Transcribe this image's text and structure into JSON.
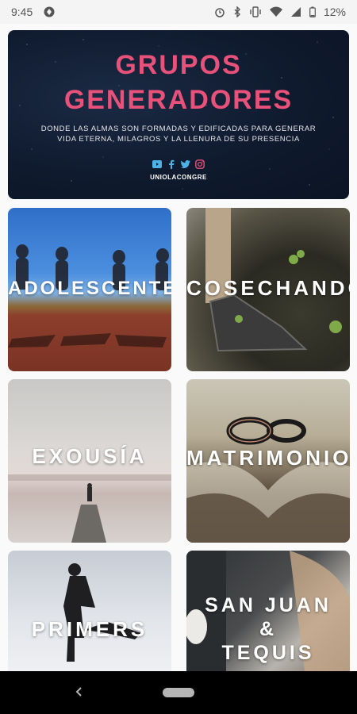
{
  "status_bar": {
    "time": "9:45",
    "battery": "12%",
    "icons": [
      "app-notification-icon",
      "alarm-icon",
      "bluetooth-icon",
      "vibrate-icon",
      "wifi-icon",
      "signal-icon",
      "battery-icon"
    ]
  },
  "hero": {
    "title_line1": "GRUPOS",
    "title_line2": "GENERADORES",
    "subtitle_line1": "DONDE LAS ALMAS SON FORMADAS Y EDIFICADAS PARA GENERAR",
    "subtitle_line2": "VIDA ETERNA, MILAGROS Y LA LLENURA DE SU PRESENCIA",
    "handle": "UNIOLACONGRE",
    "social_icons": [
      "youtube-icon",
      "facebook-icon",
      "twitter-icon",
      "instagram-icon"
    ],
    "accent_color": "#e8517a",
    "background_color": "#0f1a2e"
  },
  "groups": [
    {
      "label": "ADOLESCENTES"
    },
    {
      "label": "COSECHANDO"
    },
    {
      "label": "EXOUSÍA"
    },
    {
      "label": "MATRIMONIOS"
    },
    {
      "label": "PRIMERS"
    },
    {
      "label_line1": "SAN JUAN",
      "label_line2": "&",
      "label_line3": "TEQUIS"
    }
  ],
  "nav": {
    "icons": [
      "back-icon",
      "home-pill-icon"
    ]
  }
}
